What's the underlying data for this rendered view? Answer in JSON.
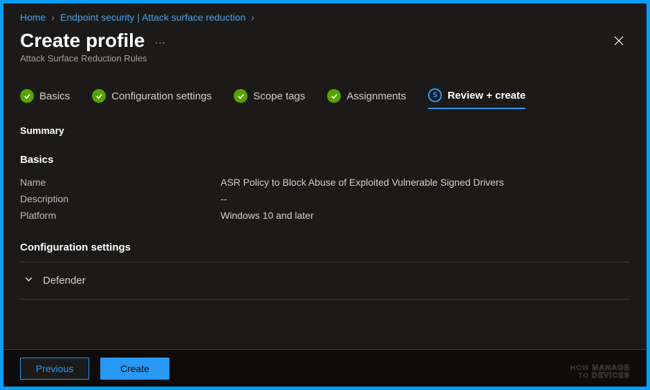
{
  "breadcrumb": {
    "home": "Home",
    "section": "Endpoint security | Attack surface reduction"
  },
  "header": {
    "title": "Create profile",
    "subtitle": "Attack Surface Reduction Rules"
  },
  "tabs": [
    {
      "label": "Basics",
      "state": "done"
    },
    {
      "label": "Configuration settings",
      "state": "done"
    },
    {
      "label": "Scope tags",
      "state": "done"
    },
    {
      "label": "Assignments",
      "state": "done"
    },
    {
      "label": "Review + create",
      "state": "active",
      "number": "5"
    }
  ],
  "summary": {
    "heading": "Summary",
    "basics_heading": "Basics",
    "rows": {
      "name": {
        "label": "Name",
        "value": "ASR Policy to Block Abuse of Exploited Vulnerable Signed Drivers"
      },
      "description": {
        "label": "Description",
        "value": "--"
      },
      "platform": {
        "label": "Platform",
        "value": "Windows 10 and later"
      }
    },
    "config_heading": "Configuration settings",
    "expander_label": "Defender"
  },
  "footer": {
    "previous": "Previous",
    "create": "Create"
  },
  "watermark": {
    "l1": "HOW",
    "l2": "TO",
    "l3": "MANAGE",
    "l4": "DEVICES"
  }
}
